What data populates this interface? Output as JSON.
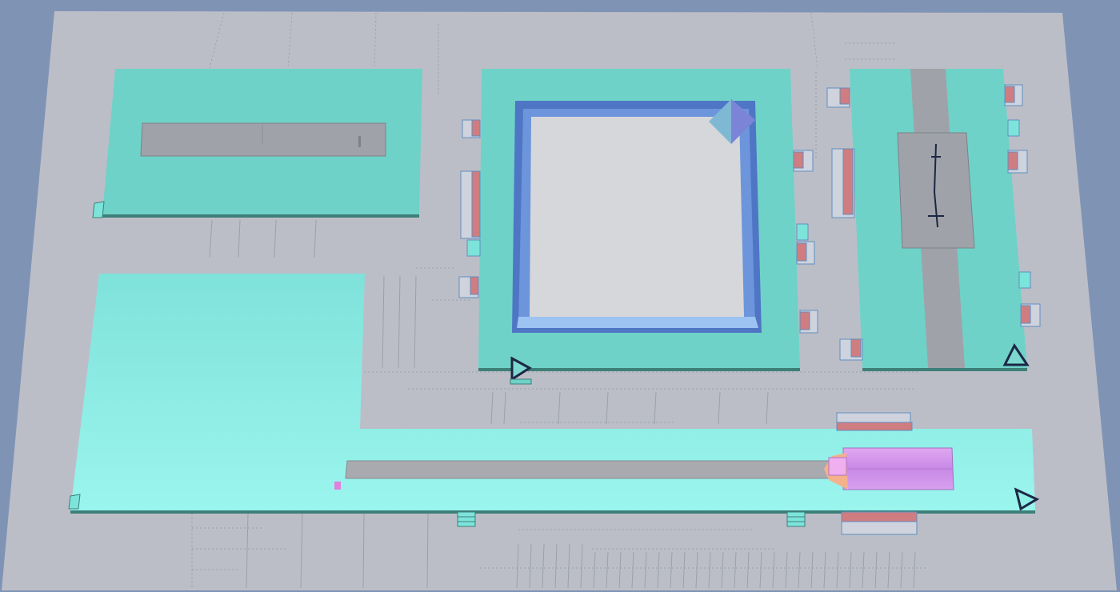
{
  "viewport": {
    "background": "#7f93b5"
  },
  "colors": {
    "ground": "#bcbec7",
    "grid_lines": "#9aa0aa",
    "building_teal": "#6fd2c8",
    "building_teal_light": "#90efe6",
    "building_shadow": "#3d7f79",
    "roof_gray": "#9fa2a9",
    "pool_frame": "#5d85cf",
    "pool_inner": "#d6d7da",
    "diamond_marker": "#7b84d6",
    "pink_block": "#cf7d80",
    "magenta_strip": "#d79ae8",
    "orange_entry": "#f3b18c",
    "triangle_marker": "#1d2744"
  },
  "scene": {
    "buildings": [
      "top-left",
      "center-pool",
      "right-tall",
      "bottom-long"
    ],
    "markers": [
      "triangle-marker-a",
      "triangle-marker-b",
      "triangle-marker-c",
      "diamond-marker"
    ]
  }
}
